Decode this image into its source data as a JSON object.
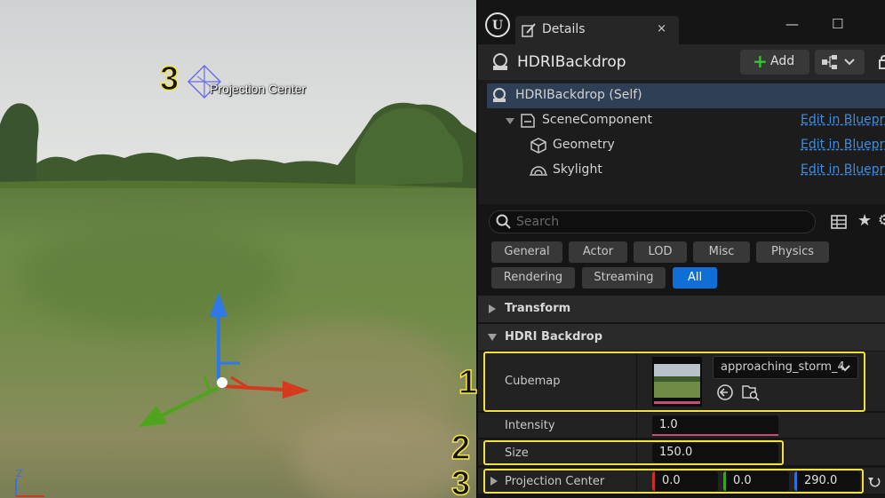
{
  "viewport": {
    "gizmo_label": "Projection Center",
    "axis_label_z": "Z"
  },
  "annotations": [
    "1",
    "2",
    "3",
    "3"
  ],
  "panel": {
    "tab_title": "Details",
    "tab_close": "×",
    "window_buttons": {
      "minimize": "—",
      "maximize": "☐"
    },
    "actor_name": "HDRIBackdrop",
    "add_button_label": "Add",
    "components": [
      {
        "label": "HDRIBackdrop (Self)",
        "selected": true
      },
      {
        "label": "SceneComponent",
        "link": "Edit in Blueprint"
      },
      {
        "label": "Geometry",
        "link": "Edit in Blueprint"
      },
      {
        "label": "Skylight",
        "link": "Edit in Blueprint"
      }
    ],
    "search_placeholder": "Search",
    "filters": [
      "General",
      "Actor",
      "LOD",
      "Misc",
      "Physics",
      "Rendering",
      "Streaming",
      "All"
    ],
    "active_filter": "All",
    "categories": {
      "transform": "Transform",
      "hdri_backdrop": "HDRI Backdrop"
    },
    "properties": {
      "cubemap_label": "Cubemap",
      "cubemap_value": "approaching_storm_4",
      "intensity_label": "Intensity",
      "intensity_value": "1.0",
      "size_label": "Size",
      "size_value": "150.0",
      "projection_center_label": "Projection Center",
      "projection_center_x": "0.0",
      "projection_center_y": "0.0",
      "projection_center_z": "290.0"
    }
  },
  "colors": {
    "accent": "#0f6fd6",
    "link": "#3e8de0",
    "highlight_box": "#f0e040",
    "selection": "#2e3f56"
  }
}
